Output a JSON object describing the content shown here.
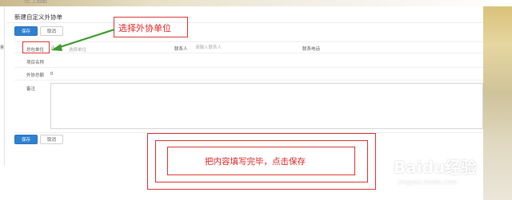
{
  "top_strip_text": "7/2...1 30081",
  "side_mark": "量",
  "page": {
    "title": "新建自定义外协单"
  },
  "toolbar_top": {
    "save_label": "保存",
    "cancel_label": "取消"
  },
  "toolbar_bottom": {
    "save_label": "保存",
    "cancel_label": "取消"
  },
  "form": {
    "unit": {
      "label": "总包单位",
      "placeholder_part1": "请",
      "placeholder_part2": "选择单位"
    },
    "contact": {
      "label": "联系人",
      "placeholder": "请输入联系人"
    },
    "phone": {
      "label": "联系电话"
    },
    "project": {
      "label": "项目名称"
    },
    "amount": {
      "label": "外协总额",
      "value": "0"
    },
    "remark": {
      "label": "备注"
    }
  },
  "annotations": {
    "select_unit": "选择外协单位",
    "fill_and_save": "把内容填写完毕，点击保存"
  },
  "watermark": {
    "main": "Baidu经验",
    "sub": "jingyan.baidu.com"
  },
  "colors": {
    "primary": "#2f80d1",
    "annotation_red": "#e03030",
    "arrow_green": "#3a9a2a"
  }
}
